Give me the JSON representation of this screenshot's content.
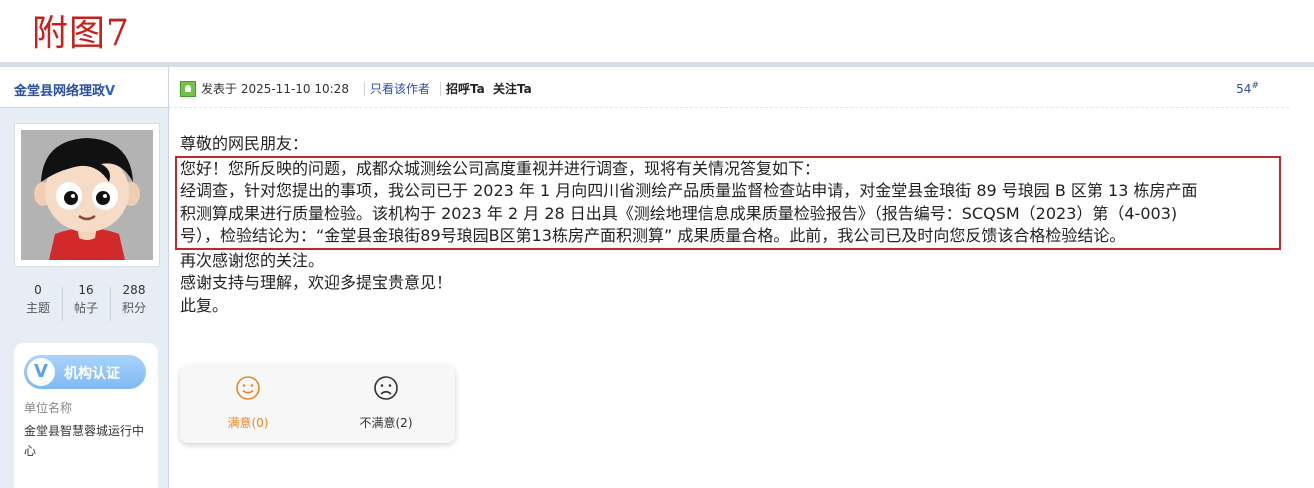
{
  "figure_label": "附图7",
  "author": {
    "name": "金堂县网络理政",
    "badge": "V",
    "stats": [
      {
        "value": "0",
        "label": "主题"
      },
      {
        "value": "16",
        "label": "帖子"
      },
      {
        "value": "288",
        "label": "积分"
      }
    ],
    "certification": {
      "icon_letter": "V",
      "label": "机构认证",
      "unit_label": "单位名称",
      "unit_name": "金堂县智慧蓉城运行中心"
    }
  },
  "post": {
    "posted_at": "发表于 2025-11-10 10:28",
    "only_author": "只看该作者",
    "greet": "招呼Ta",
    "follow": "关注Ta",
    "floor": "54",
    "floor_mark": "#",
    "content": {
      "salutation": "尊敬的网民朋友：",
      "boxed_lines": [
        "您好！您所反映的问题，成都众城测绘公司高度重视并进行调查，现将有关情况答复如下：",
        "经调查，针对您提出的事项，我公司已于 2023 年 1 月向四川省测绘产品质量监督检查站申请，对金堂县金琅街 89 号琅园 B 区第 13 栋房产面",
        "积测算成果进行质量检验。该机构于 2023 年 2 月 28 日出具《测绘地理信息成果质量检验报告》（报告编号：SCQSM（2023）第（4-003)",
        "号），检验结论为：“金堂县金琅街89号琅园B区第13栋房产面积测算” 成果质量合格。此前，我公司已及时向您反馈该合格检验结论。"
      ],
      "closing_lines": [
        "再次感谢您的关注。",
        "感谢支持与理解，欢迎多提宝贵意见！",
        "此复。"
      ]
    },
    "rating": {
      "satisfied": {
        "label": "满意(0)",
        "color": "#e8892b"
      },
      "unsatisfied": {
        "label": "不满意(2)",
        "color": "#333333"
      }
    }
  },
  "colors": {
    "figure_label": "#c8201b",
    "link": "#2b4f9e",
    "highlight_border": "#c0282d",
    "sidebar_bg": "#e6edf5"
  }
}
